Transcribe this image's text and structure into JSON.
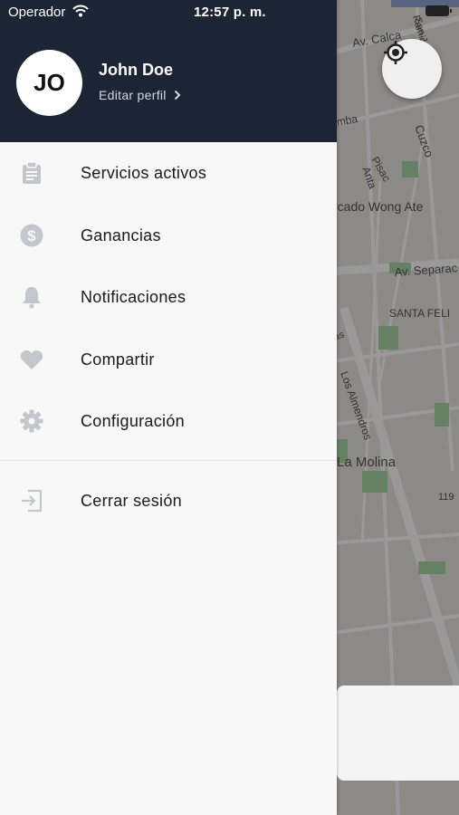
{
  "status_bar": {
    "carrier": "Operador",
    "time": "12:57 p. m."
  },
  "map": {
    "labels": [
      "Av. Calca",
      "San Juan",
      "Ramir",
      "Cuzco",
      "Pisac",
      "Anta",
      "amba",
      "rcado Wong Ate",
      "Av. Separac",
      "SANTA FELI",
      "as",
      "Los Almendros",
      "La Molina",
      "119"
    ]
  },
  "profile": {
    "initials": "JO",
    "name": "John Doe",
    "edit_label": "Editar perfil"
  },
  "menu": {
    "items": [
      {
        "label": "Servicios activos",
        "icon": "clipboard-icon"
      },
      {
        "label": "Ganancias",
        "icon": "dollar-coin-icon"
      },
      {
        "label": "Notificaciones",
        "icon": "bell-icon"
      },
      {
        "label": "Compartir",
        "icon": "heart-icon"
      },
      {
        "label": "Configuración",
        "icon": "gear-icon"
      }
    ],
    "logout": {
      "label": "Cerrar sesión",
      "icon": "logout-icon"
    }
  },
  "colors": {
    "header_bg": "#1c2534",
    "icon_gray": "#c3c6cd",
    "drawer_bg": "#f8f8f8"
  }
}
